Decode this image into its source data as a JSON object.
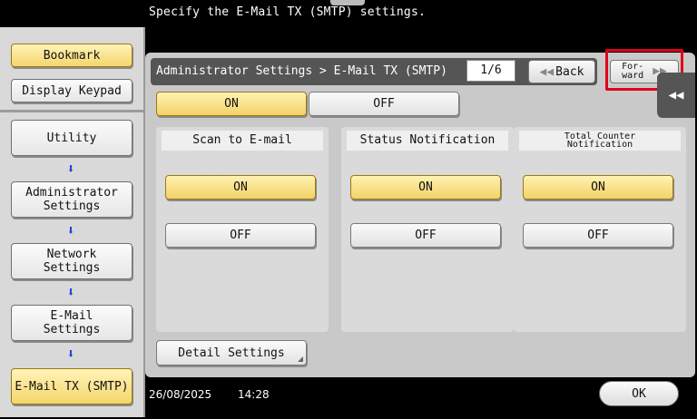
{
  "instruction": "Specify the E-Mail TX (SMTP) settings.",
  "sidebar": {
    "bookmark": "Bookmark",
    "display_keypad": "Display Keypad",
    "breadcrumbs": [
      {
        "label_line1": "Utility",
        "label_line2": ""
      },
      {
        "label_line1": "Administrator",
        "label_line2": "Settings"
      },
      {
        "label_line1": "Network",
        "label_line2": "Settings"
      },
      {
        "label_line1": "E-Mail",
        "label_line2": "Settings"
      },
      {
        "label_line1": "E-Mail TX (SMTP)",
        "label_line2": ""
      }
    ]
  },
  "header": {
    "title": "Administrator Settings > E-Mail TX (SMTP)",
    "page_indicator": "1/6",
    "back_label": "Back",
    "forward_line1": "For-",
    "forward_line2": "ward"
  },
  "toggle": {
    "on_label": "ON",
    "off_label": "OFF",
    "selected": "ON"
  },
  "columns": [
    {
      "title": "Scan to E-mail",
      "title_line2": "",
      "on_label": "ON",
      "off_label": "OFF",
      "selected": "ON"
    },
    {
      "title": "Status Notification",
      "title_line2": "",
      "on_label": "ON",
      "off_label": "OFF",
      "selected": "ON"
    },
    {
      "title": "Total Counter",
      "title_line2": "Notification",
      "on_label": "ON",
      "off_label": "OFF",
      "selected": "ON"
    }
  ],
  "detail_settings": "Detail Settings",
  "status": {
    "date": "26/08/2025",
    "time": "14:28"
  },
  "ok_label": "OK",
  "colors": {
    "selected_button": "#f3d266",
    "highlight_box": "#e0001a",
    "arrow": "#1d47d8"
  }
}
